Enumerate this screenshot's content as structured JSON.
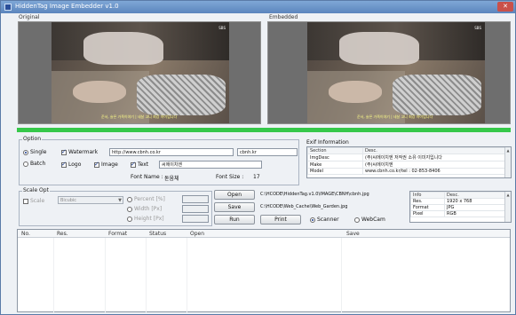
{
  "window": {
    "title": "HiddenTag Image Embedder v1.0"
  },
  "panes": {
    "original_label": "Original",
    "embedded_label": "Embedded",
    "caption": "준서, 슬픈 가족이야기 | 네살 고니 최강 아이입니다",
    "badge": "SBS"
  },
  "progress": {
    "fraction": 1.0,
    "color": "#36c84a"
  },
  "option": {
    "title": "Option",
    "single_label": "Single",
    "single_selected": true,
    "batch_label": "Batch",
    "batch_selected": false,
    "watermark_label": "Watermark",
    "watermark_checked": true,
    "watermark_url": "http://www.cbnh.co.kr",
    "watermark_domain": "cbnh.kr",
    "logo_label": "Logo",
    "logo_checked": true,
    "image_label": "Image",
    "image_checked": true,
    "text_label": "Text",
    "text_checked": true,
    "text_value": "씨에이치엔",
    "font_name_label": "Font Name :",
    "font_name_value": "돋움체",
    "font_size_label": "Font Size :",
    "font_size_value": "17"
  },
  "scale": {
    "title": "Scale Opt",
    "scale_label": "Scale",
    "scale_checked": false,
    "combo_value": "Bicubic",
    "percent_label": "Percent [%]",
    "width_label": "Width [Px]",
    "height_label": "Height [Px]"
  },
  "buttons": {
    "open": "Open",
    "save": "Save",
    "run": "Run",
    "print": "Print"
  },
  "paths": {
    "open_path": "C:\\HCODE\\HiddenTag.v1.0\\IMAGE\\CBNH\\cbnh.jpg",
    "save_path": "C:\\HCODE\\Web_Cache\\Web_Garden.jpg"
  },
  "source": {
    "scanner_label": "Scanner",
    "scanner_selected": true,
    "webcam_label": "WebCam",
    "webcam_selected": false
  },
  "exif": {
    "title": "Exif Information",
    "headers": [
      "Section",
      "Desc."
    ],
    "rows": [
      [
        "ImgDesc",
        "(주)씨에이치엔 저작권 소유 이미지입니다"
      ],
      [
        "Make",
        "(주)씨에이치엔"
      ],
      [
        "Model",
        "www.cbnh.co.kr/tel : 02-853-8406"
      ]
    ]
  },
  "info": {
    "headers": [
      "Info",
      "Desc."
    ],
    "rows": [
      [
        "Res.",
        "1920 x 768"
      ],
      [
        "Format",
        "JPG"
      ],
      [
        "Pixel",
        "RGB"
      ]
    ]
  },
  "results": {
    "headers": [
      "No.",
      "Res.",
      "Format",
      "Status",
      "Open",
      "Save"
    ]
  }
}
